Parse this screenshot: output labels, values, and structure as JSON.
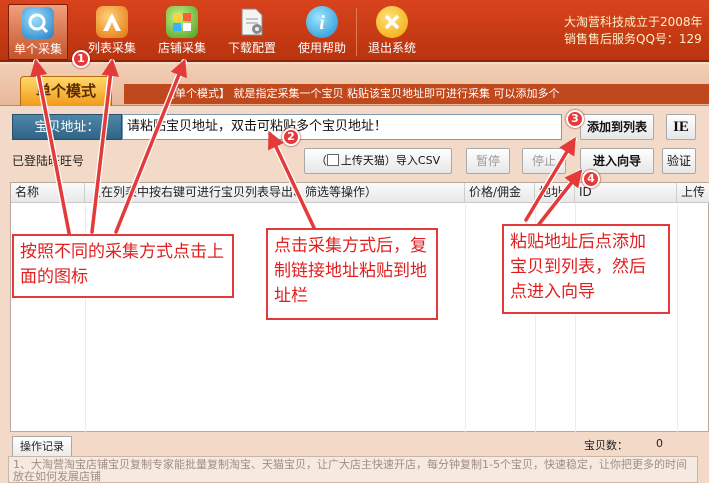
{
  "toolbar": {
    "buttons": [
      {
        "label": "单个采集",
        "icon": "single-collect-icon",
        "active": true
      },
      {
        "label": "列表采集",
        "icon": "list-collect-icon"
      },
      {
        "label": "店铺采集",
        "icon": "shop-collect-icon"
      },
      {
        "label": "下载配置",
        "icon": "download-config-icon"
      },
      {
        "label": "使用帮助",
        "icon": "help-icon"
      },
      {
        "label": "退出系统",
        "icon": "exit-icon"
      }
    ],
    "company_line1": "大淘营科技成立于2008年",
    "company_line2": "销售售后服务QQ号：129"
  },
  "mode": {
    "tab_label": "单个模式",
    "description": "【单个模式】 就是指定采集一个宝贝  粘贴该宝贝地址即可进行采集  可以添加多个"
  },
  "address": {
    "label": "宝贝地址：",
    "value": "请粘贴宝贝地址，双击可粘贴多个宝贝地址！",
    "add_button": "添加到列表",
    "ie_button": "IE"
  },
  "row2": {
    "logged_in": "已登陆旺旺号",
    "upload_open": "（",
    "upload_label": "上传天猫）导入CSV",
    "pause_button": "暂停",
    "stop_button": "停止",
    "wizard_button": "进入向导",
    "verify_button": "验证"
  },
  "table": {
    "columns": [
      "名称",
      "（在列表中按右键可进行宝贝列表导出、筛选等操作）",
      "价格/佣金",
      "地址",
      "ID",
      "上传"
    ]
  },
  "log": {
    "tab": "操作记录",
    "count_label": "宝贝数：",
    "count_value": "0",
    "text": "1、大淘营淘宝店铺宝贝复制专家能批量复制淘宝、天猫宝贝，让广大店主快速开店，每分钟复制1-5个宝贝，快速稳定，让你把更多的时间放在如何发展店铺"
  },
  "annotations": {
    "note1": "按照不同的采集方式点击上面的图标",
    "note2": "点击采集方式后，复制链接地址粘贴到地址栏",
    "note3": "粘贴地址后点添加宝贝到列表，然后点进入向导",
    "badges": [
      "1",
      "2",
      "3",
      "4"
    ]
  },
  "colors": {
    "toolbar": "#c93d16",
    "annotation": "#e33a3a",
    "address_label": "#3a709a"
  }
}
